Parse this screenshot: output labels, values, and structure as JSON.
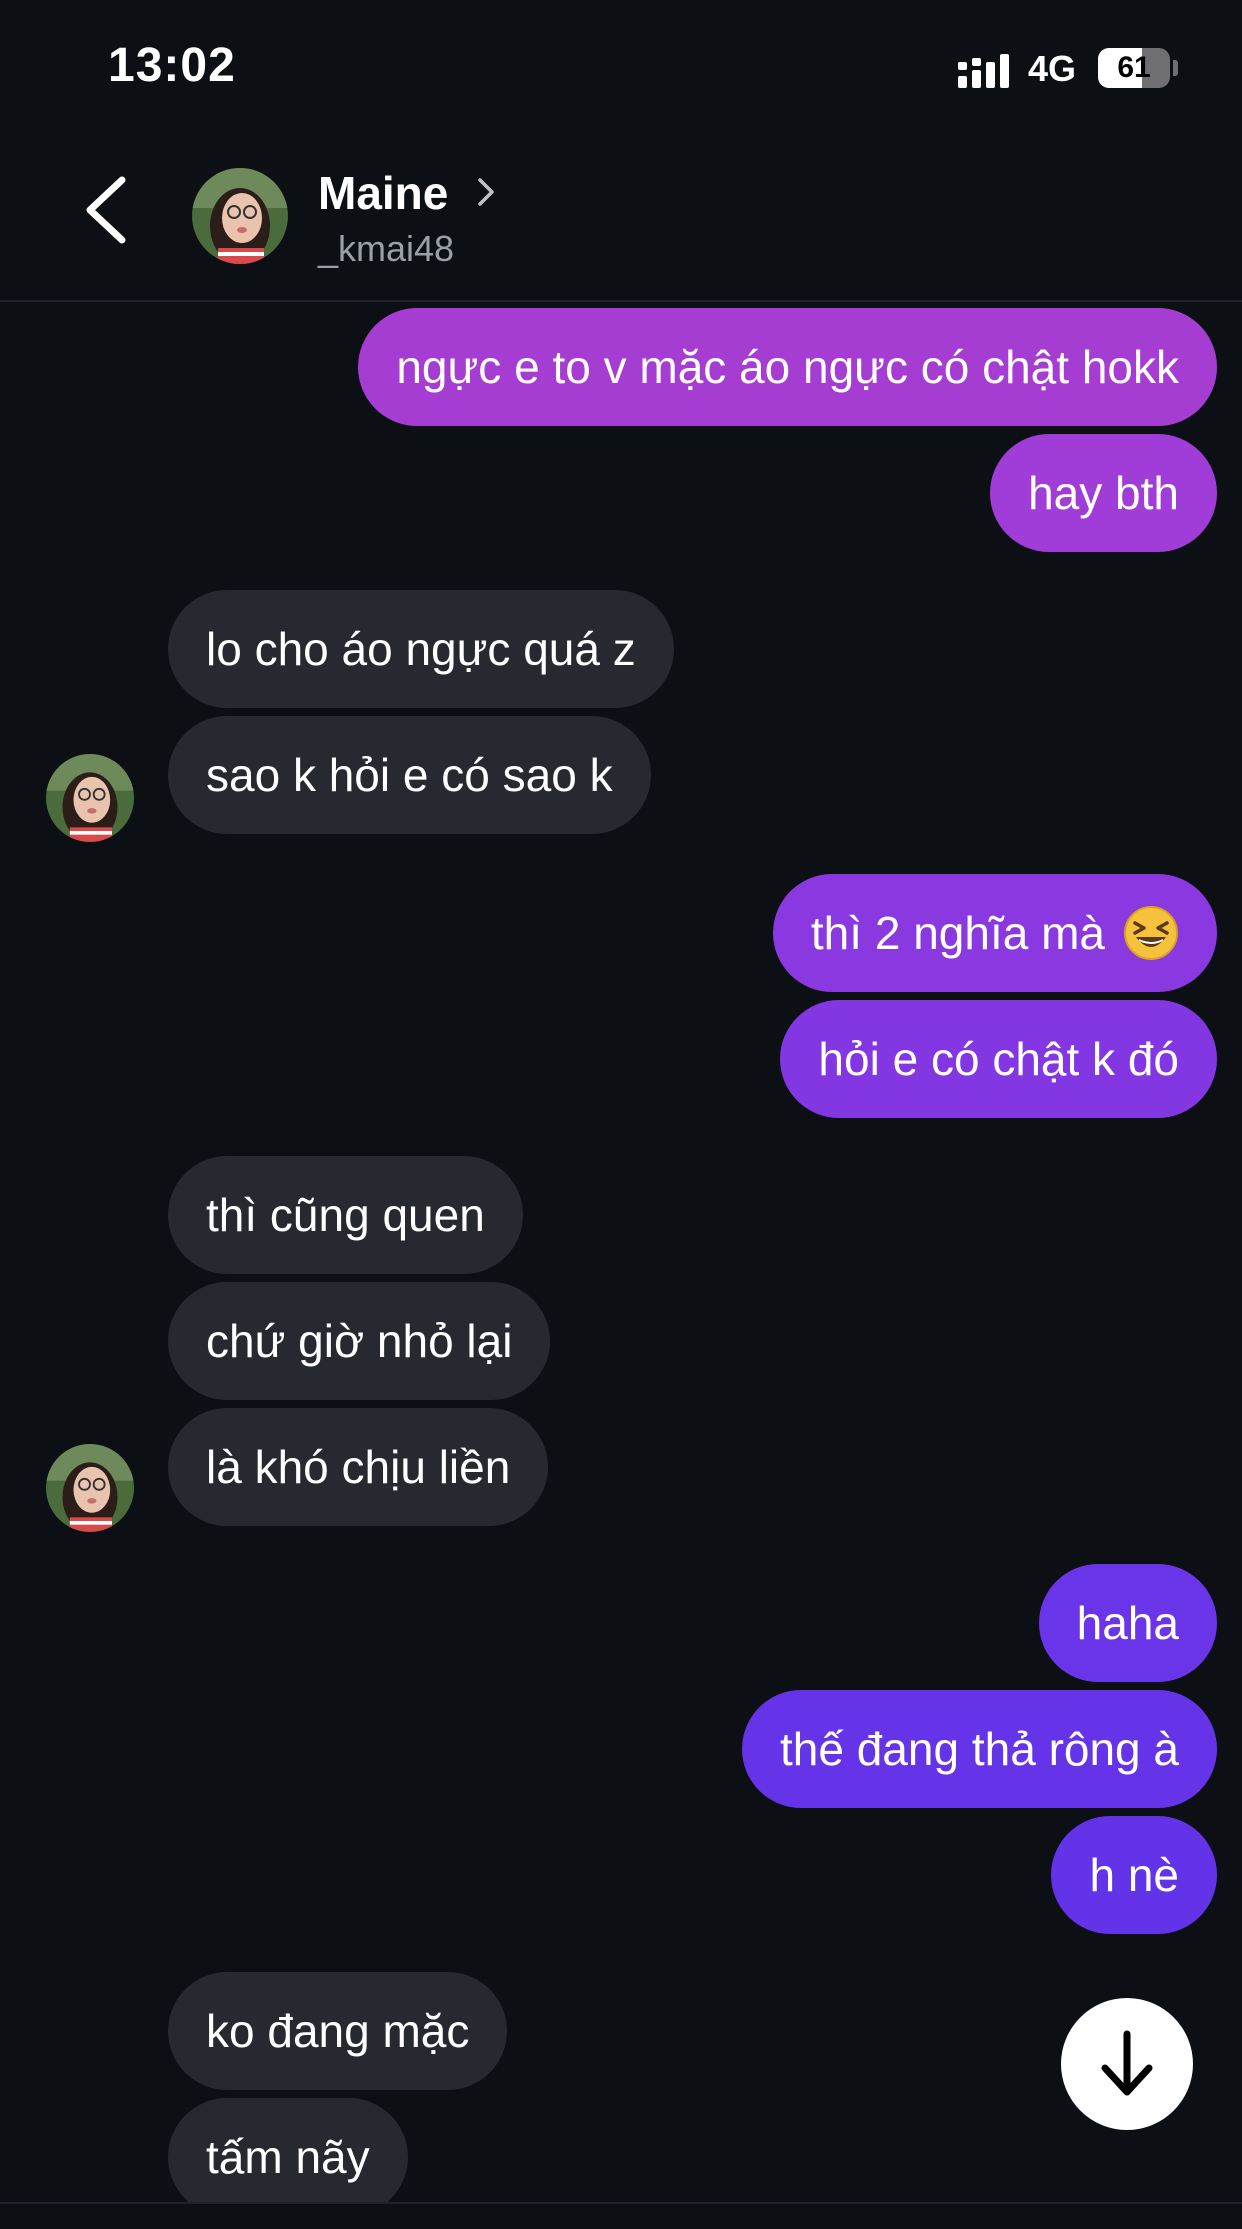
{
  "status_bar": {
    "time": "13:02",
    "network": "4G",
    "battery_level": "61",
    "battery_fraction": 0.61
  },
  "header": {
    "name": "Maine",
    "handle": "_kmai48"
  },
  "messages": [
    {
      "dir": "out",
      "text": "ngực e to v mặc áo ngực có chật hokk",
      "color": "#a53dd2"
    },
    {
      "dir": "out",
      "text": "hay bth",
      "color": "#a03dd8"
    },
    {
      "dir": "in",
      "text": "lo cho áo ngực quá z"
    },
    {
      "dir": "in",
      "text": "sao k hỏi e có sao k"
    },
    {
      "dir": "out",
      "text": "thì 2 nghĩa mà",
      "emoji": "laughing-face-emoji",
      "color": "#8a39e0"
    },
    {
      "dir": "out",
      "text": "hỏi e có chật k đó",
      "color": "#8237e2"
    },
    {
      "dir": "in",
      "text": "thì cũng quen"
    },
    {
      "dir": "in",
      "text": "chứ giờ nhỏ lại"
    },
    {
      "dir": "in",
      "text": "là khó chịu liền"
    },
    {
      "dir": "out",
      "text": "haha",
      "color": "#6a35e8"
    },
    {
      "dir": "out",
      "text": "thế đang thả rông à",
      "color": "#6634e8"
    },
    {
      "dir": "out",
      "text": "h nè",
      "color": "#6233e9"
    },
    {
      "dir": "in",
      "text": "ko đang mặc"
    },
    {
      "dir": "in",
      "text": "tấm nãy"
    }
  ],
  "colors": {
    "background": "#0c0f14",
    "incoming_bubble": "#26292f",
    "text_secondary": "#9aa0a6"
  }
}
